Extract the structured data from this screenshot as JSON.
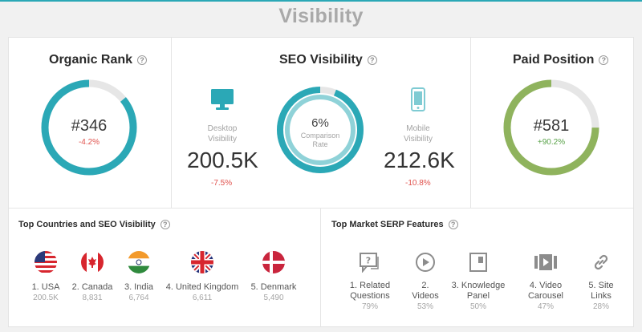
{
  "page": {
    "title": "Visibility"
  },
  "organic_rank": {
    "title": "Organic Rank",
    "value": "#346",
    "delta": "-4.2%",
    "progress": 0.86
  },
  "seo_visibility": {
    "title": "SEO Visibility",
    "desktop": {
      "label_line1": "Desktop",
      "label_line2": "Visibility",
      "value": "200.5K",
      "delta": "-7.5%"
    },
    "mobile": {
      "label_line1": "Mobile",
      "label_line2": "Visibility",
      "value": "212.6K",
      "delta": "-10.8%"
    },
    "comparison": {
      "value": "6%",
      "label_line1": "Comparison",
      "label_line2": "Rate",
      "progress": 0.94
    }
  },
  "paid_position": {
    "title": "Paid Position",
    "value": "#581",
    "delta": "+90.2%",
    "progress": 0.75
  },
  "top_countries": {
    "title": "Top Countries and SEO Visibility",
    "items": [
      {
        "name": "1. USA",
        "value": "200.5K",
        "flag": "us-flag-icon"
      },
      {
        "name": "2. Canada",
        "value": "8,831",
        "flag": "canada-flag-icon"
      },
      {
        "name": "3. India",
        "value": "6,764",
        "flag": "india-flag-icon"
      },
      {
        "name": "4. United Kingdom",
        "value": "6,611",
        "flag": "uk-flag-icon"
      },
      {
        "name": "5. Denmark",
        "value": "5,490",
        "flag": "denmark-flag-icon"
      }
    ]
  },
  "top_serp": {
    "title": "Top Market SERP Features",
    "items": [
      {
        "line1": "1. Related",
        "line2": "Questions",
        "value": "79%",
        "icon": "related-questions-icon"
      },
      {
        "line1": "2.",
        "line2": "Videos",
        "value": "53%",
        "icon": "video-play-icon"
      },
      {
        "line1": "3. Knowledge",
        "line2": "Panel",
        "value": "50%",
        "icon": "knowledge-panel-icon"
      },
      {
        "line1": "4. Video",
        "line2": "Carousel",
        "value": "47%",
        "icon": "video-carousel-icon"
      },
      {
        "line1": "5. Site",
        "line2": "Links",
        "value": "28%",
        "icon": "site-links-icon"
      }
    ]
  },
  "colors": {
    "teal": "#2ba8b6",
    "light_teal": "#8fd2d8",
    "green": "#8fb35d",
    "track": "#e6e6e6",
    "negative": "#e0524d",
    "positive": "#5aa34a"
  }
}
